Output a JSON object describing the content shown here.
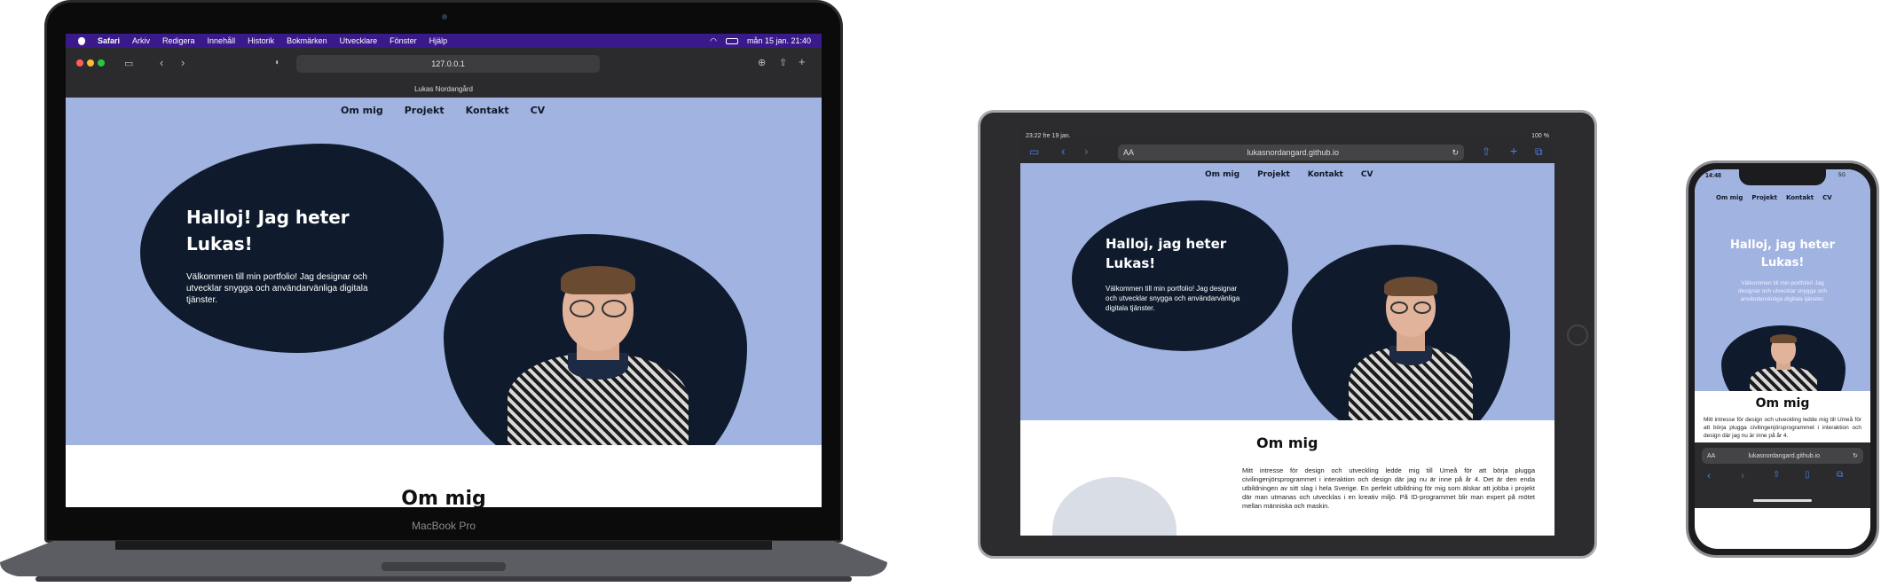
{
  "mac": {
    "label": "MacBook Pro",
    "menubar": {
      "apple": "",
      "app": "Safari",
      "items": [
        "Arkiv",
        "Redigera",
        "Innehåll",
        "Historik",
        "Bokmärken",
        "Utvecklare",
        "Fönster",
        "Hjälp"
      ],
      "clock": "mån 15 jan.  21:40"
    },
    "url": "127.0.0.1",
    "tab_title": "Lukas Nordangård",
    "nav": [
      "Om mig",
      "Projekt",
      "Kontakt",
      "CV"
    ],
    "hero_title": "Halloj! Jag heter Lukas!",
    "hero_text": "Välkommen till min portfolio! Jag designar och utvecklar snygga och användarvänliga digitala tjänster.",
    "section_title": "Om mig"
  },
  "ipad": {
    "status_time": "23:22  fre 19 jan.",
    "status_battery": "100 %",
    "aa": "AA",
    "url": "lukasnordangard.github.io",
    "nav": [
      "Om mig",
      "Projekt",
      "Kontakt",
      "CV"
    ],
    "hero_title": "Halloj, jag heter Lukas!",
    "hero_text": "Välkommen till min portfolio! Jag designar och utvecklar snygga och användarvänliga digitala tjänster.",
    "section_title": "Om mig",
    "about_text": "Mitt intresse för design och utveckling ledde mig till Umeå för att börja plugga civilingenjörsprogrammet i interaktion och design där jag nu är inne på år 4. Det är den enda utbildningen av sitt slag i hela Sverige. En perfekt utbildning för mig som älskar att jobba i projekt där man utmanas och utvecklas i en kreativ miljö. På ID-programmet blir man expert på mötet mellan människa och maskin."
  },
  "iphone": {
    "status_time": "14:48",
    "status_signal": "5G",
    "nav": [
      "Om mig",
      "Projekt",
      "Kontakt",
      "CV"
    ],
    "hero_title": "Halloj, jag heter Lukas!",
    "hero_text": "Välkommen till min portfolio! Jag designar och utvecklar snygga och användarvänliga digitala tjänster.",
    "section_title": "Om mig",
    "about_text": "Mitt intresse för design och utveckling ledde mig till Umeå för att börja plugga civilingenjörsprogrammet i interaktion och design där jag nu är inne på år 4.",
    "aa": "AA",
    "url": "lukasnordangard.github.io"
  },
  "colors": {
    "hero_bg": "#a1b3e1",
    "blob": "#0f1b2d",
    "menubar": "#3a1a8a"
  }
}
